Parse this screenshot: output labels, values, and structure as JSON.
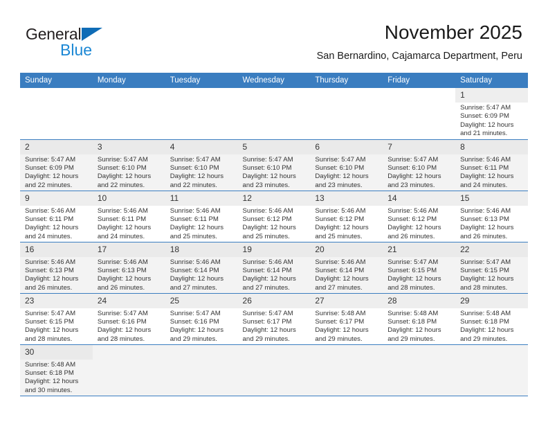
{
  "brand": {
    "name_top": "General",
    "name_bottom": "Blue",
    "triangle_color": "#0f6cb6",
    "blue_color": "#1b87d4"
  },
  "header": {
    "title": "November 2025",
    "subtitle": "San Bernardino, Cajamarca Department, Peru"
  },
  "theme": {
    "header_bg": "#3a7dc0",
    "header_text": "#ffffff",
    "row_alt_bg": "#f3f3f3",
    "daynum_bg": "#eeeeee",
    "border": "#3a7dc0"
  },
  "calendar": {
    "weekday_headers": [
      "Sunday",
      "Monday",
      "Tuesday",
      "Wednesday",
      "Thursday",
      "Friday",
      "Saturday"
    ],
    "weeks": [
      [
        {
          "day": "",
          "info": ""
        },
        {
          "day": "",
          "info": ""
        },
        {
          "day": "",
          "info": ""
        },
        {
          "day": "",
          "info": ""
        },
        {
          "day": "",
          "info": ""
        },
        {
          "day": "",
          "info": ""
        },
        {
          "day": "1",
          "info": "Sunrise: 5:47 AM\nSunset: 6:09 PM\nDaylight: 12 hours\nand 21 minutes."
        }
      ],
      [
        {
          "day": "2",
          "info": "Sunrise: 5:47 AM\nSunset: 6:09 PM\nDaylight: 12 hours\nand 22 minutes."
        },
        {
          "day": "3",
          "info": "Sunrise: 5:47 AM\nSunset: 6:10 PM\nDaylight: 12 hours\nand 22 minutes."
        },
        {
          "day": "4",
          "info": "Sunrise: 5:47 AM\nSunset: 6:10 PM\nDaylight: 12 hours\nand 22 minutes."
        },
        {
          "day": "5",
          "info": "Sunrise: 5:47 AM\nSunset: 6:10 PM\nDaylight: 12 hours\nand 23 minutes."
        },
        {
          "day": "6",
          "info": "Sunrise: 5:47 AM\nSunset: 6:10 PM\nDaylight: 12 hours\nand 23 minutes."
        },
        {
          "day": "7",
          "info": "Sunrise: 5:47 AM\nSunset: 6:10 PM\nDaylight: 12 hours\nand 23 minutes."
        },
        {
          "day": "8",
          "info": "Sunrise: 5:46 AM\nSunset: 6:11 PM\nDaylight: 12 hours\nand 24 minutes."
        }
      ],
      [
        {
          "day": "9",
          "info": "Sunrise: 5:46 AM\nSunset: 6:11 PM\nDaylight: 12 hours\nand 24 minutes."
        },
        {
          "day": "10",
          "info": "Sunrise: 5:46 AM\nSunset: 6:11 PM\nDaylight: 12 hours\nand 24 minutes."
        },
        {
          "day": "11",
          "info": "Sunrise: 5:46 AM\nSunset: 6:11 PM\nDaylight: 12 hours\nand 25 minutes."
        },
        {
          "day": "12",
          "info": "Sunrise: 5:46 AM\nSunset: 6:12 PM\nDaylight: 12 hours\nand 25 minutes."
        },
        {
          "day": "13",
          "info": "Sunrise: 5:46 AM\nSunset: 6:12 PM\nDaylight: 12 hours\nand 25 minutes."
        },
        {
          "day": "14",
          "info": "Sunrise: 5:46 AM\nSunset: 6:12 PM\nDaylight: 12 hours\nand 26 minutes."
        },
        {
          "day": "15",
          "info": "Sunrise: 5:46 AM\nSunset: 6:13 PM\nDaylight: 12 hours\nand 26 minutes."
        }
      ],
      [
        {
          "day": "16",
          "info": "Sunrise: 5:46 AM\nSunset: 6:13 PM\nDaylight: 12 hours\nand 26 minutes."
        },
        {
          "day": "17",
          "info": "Sunrise: 5:46 AM\nSunset: 6:13 PM\nDaylight: 12 hours\nand 26 minutes."
        },
        {
          "day": "18",
          "info": "Sunrise: 5:46 AM\nSunset: 6:14 PM\nDaylight: 12 hours\nand 27 minutes."
        },
        {
          "day": "19",
          "info": "Sunrise: 5:46 AM\nSunset: 6:14 PM\nDaylight: 12 hours\nand 27 minutes."
        },
        {
          "day": "20",
          "info": "Sunrise: 5:46 AM\nSunset: 6:14 PM\nDaylight: 12 hours\nand 27 minutes."
        },
        {
          "day": "21",
          "info": "Sunrise: 5:47 AM\nSunset: 6:15 PM\nDaylight: 12 hours\nand 28 minutes."
        },
        {
          "day": "22",
          "info": "Sunrise: 5:47 AM\nSunset: 6:15 PM\nDaylight: 12 hours\nand 28 minutes."
        }
      ],
      [
        {
          "day": "23",
          "info": "Sunrise: 5:47 AM\nSunset: 6:15 PM\nDaylight: 12 hours\nand 28 minutes."
        },
        {
          "day": "24",
          "info": "Sunrise: 5:47 AM\nSunset: 6:16 PM\nDaylight: 12 hours\nand 28 minutes."
        },
        {
          "day": "25",
          "info": "Sunrise: 5:47 AM\nSunset: 6:16 PM\nDaylight: 12 hours\nand 29 minutes."
        },
        {
          "day": "26",
          "info": "Sunrise: 5:47 AM\nSunset: 6:17 PM\nDaylight: 12 hours\nand 29 minutes."
        },
        {
          "day": "27",
          "info": "Sunrise: 5:48 AM\nSunset: 6:17 PM\nDaylight: 12 hours\nand 29 minutes."
        },
        {
          "day": "28",
          "info": "Sunrise: 5:48 AM\nSunset: 6:18 PM\nDaylight: 12 hours\nand 29 minutes."
        },
        {
          "day": "29",
          "info": "Sunrise: 5:48 AM\nSunset: 6:18 PM\nDaylight: 12 hours\nand 29 minutes."
        }
      ],
      [
        {
          "day": "30",
          "info": "Sunrise: 5:48 AM\nSunset: 6:18 PM\nDaylight: 12 hours\nand 30 minutes."
        },
        {
          "day": "",
          "info": ""
        },
        {
          "day": "",
          "info": ""
        },
        {
          "day": "",
          "info": ""
        },
        {
          "day": "",
          "info": ""
        },
        {
          "day": "",
          "info": ""
        },
        {
          "day": "",
          "info": ""
        }
      ]
    ]
  }
}
